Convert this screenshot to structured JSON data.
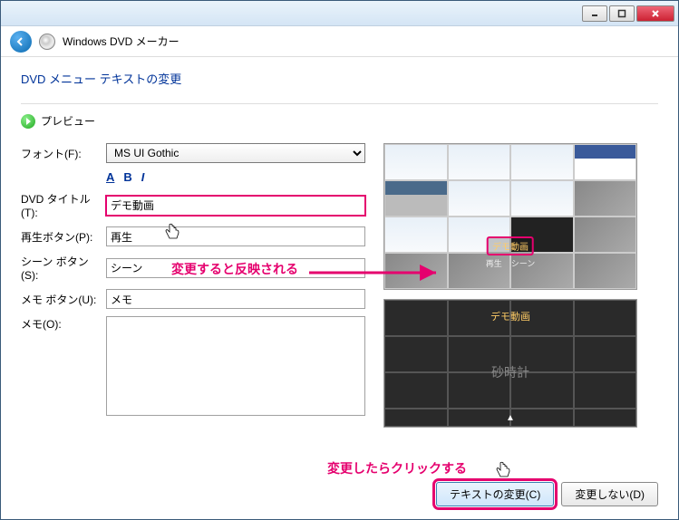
{
  "window_title": "Windows DVD メーカー",
  "page_heading": "DVD メニュー テキストの変更",
  "preview_label": "プレビュー",
  "form": {
    "font_label": "フォント(F):",
    "font_value": "MS UI Gothic",
    "title_label": "DVD タイトル(T):",
    "title_value": "デモ動画",
    "play_label": "再生ボタン(P):",
    "play_value": "再生",
    "scene_label": "シーン ボタン(S):",
    "scene_value": "シーン",
    "note_btn_label": "メモ ボタン(U):",
    "note_btn_value": "メモ",
    "note_label": "メモ(O):",
    "note_value": ""
  },
  "style_buttons": {
    "underline": "A",
    "bold": "B",
    "italic": "I"
  },
  "annotations": {
    "reflect": "変更すると反映される",
    "click_after": "変更したらクリックする"
  },
  "preview": {
    "menu_title": "デモ動画",
    "menu_play": "再生",
    "menu_scene": "シーン",
    "sub_title": "デモ動画",
    "sub_text": "砂時計"
  },
  "buttons": {
    "change": "テキストの変更(C)",
    "no_change": "変更しない(D)"
  }
}
